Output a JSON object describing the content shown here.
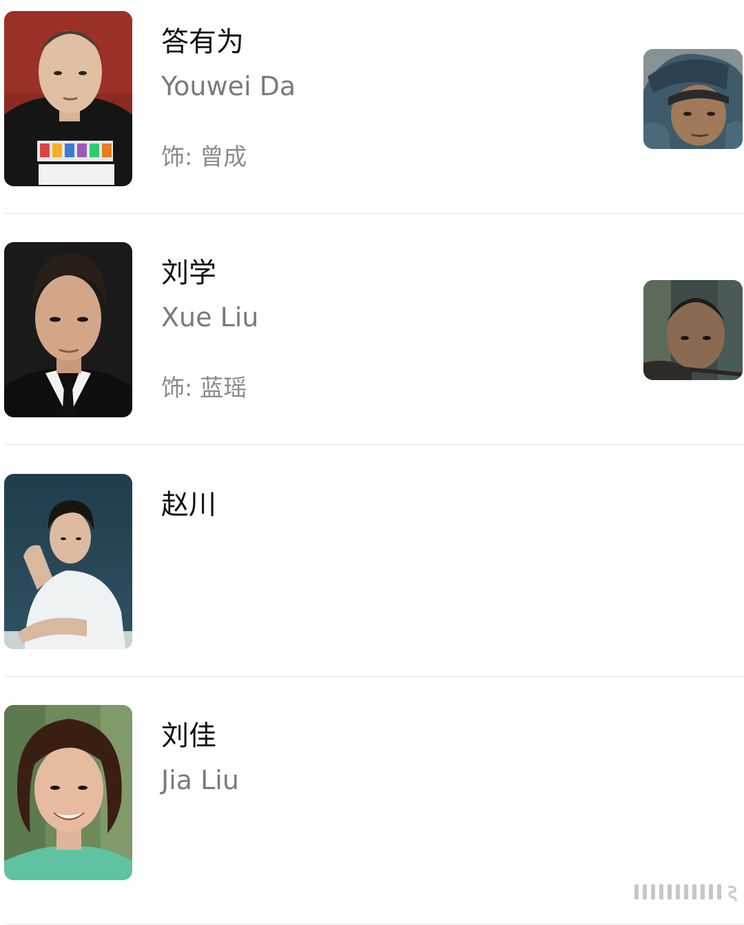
{
  "cast": [
    {
      "name": "答有为",
      "name_en": "Youwei Da",
      "role": "饰: 曾成",
      "has_still": true
    },
    {
      "name": "刘学",
      "name_en": "Xue Liu",
      "role": "饰: 蓝瑶",
      "has_still": true
    },
    {
      "name": "赵川",
      "name_en": "",
      "role": "",
      "has_still": false
    },
    {
      "name": "刘佳",
      "name_en": "Jia Liu",
      "role": "",
      "has_still": false
    }
  ],
  "colors": {
    "name_text": "#111111",
    "subtitle_text": "#7a7a7a",
    "divider": "#e6e6e6",
    "background": "#ffffff"
  }
}
